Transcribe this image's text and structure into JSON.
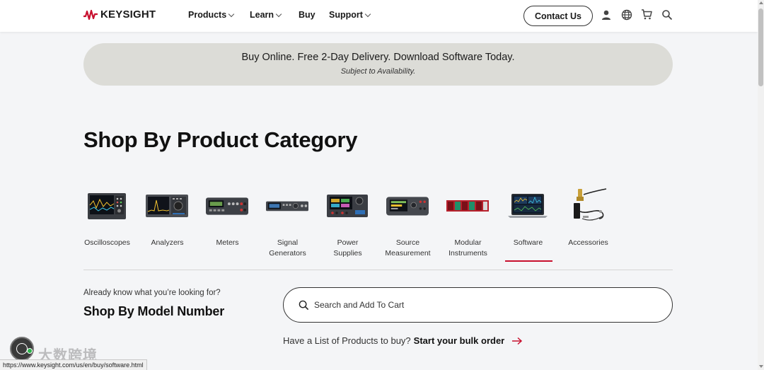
{
  "header": {
    "logo_text": "KEYSIGHT",
    "nav": [
      {
        "label": "Products",
        "has_dropdown": true
      },
      {
        "label": "Learn",
        "has_dropdown": true
      },
      {
        "label": "Buy",
        "has_dropdown": false
      },
      {
        "label": "Support",
        "has_dropdown": true
      }
    ],
    "contact_label": "Contact Us",
    "icons": [
      "user-icon",
      "globe-icon",
      "cart-icon",
      "search-icon"
    ]
  },
  "banner": {
    "main": "Buy Online. Free 2-Day Delivery. Download Software Today.",
    "sub": "Subject to Availability."
  },
  "page_title": "Shop By Product Category",
  "categories": [
    {
      "label": "Oscilloscopes",
      "icon": "oscilloscope-image",
      "selected": false
    },
    {
      "label": "Analyzers",
      "icon": "analyzer-image",
      "selected": false
    },
    {
      "label": "Meters",
      "icon": "meter-image",
      "selected": false
    },
    {
      "label": "Signal\nGenerators",
      "icon": "signal-generator-image",
      "selected": false
    },
    {
      "label": "Power\nSupplies",
      "icon": "power-supply-image",
      "selected": false
    },
    {
      "label": "Source\nMeasurement",
      "icon": "source-measurement-image",
      "selected": false
    },
    {
      "label": "Modular\nInstruments",
      "icon": "modular-instrument-image",
      "selected": false
    },
    {
      "label": "Software",
      "icon": "software-laptop-image",
      "selected": true
    },
    {
      "label": "Accessories",
      "icon": "accessories-image",
      "selected": false
    }
  ],
  "model_section": {
    "already": "Already know what you’re looking for?",
    "title": "Shop By Model Number",
    "search_placeholder": "Search and Add To Cart",
    "bulk_text": "Have a List of Products to buy?",
    "bulk_link": "Start your bulk order"
  },
  "status_url": "https://www.keysight.com/us/en/buy/software.html",
  "watermark": "大数跨境",
  "colors": {
    "accent": "#c8102e",
    "banner": "#dcdcd7",
    "background": "#f4f5f7"
  }
}
